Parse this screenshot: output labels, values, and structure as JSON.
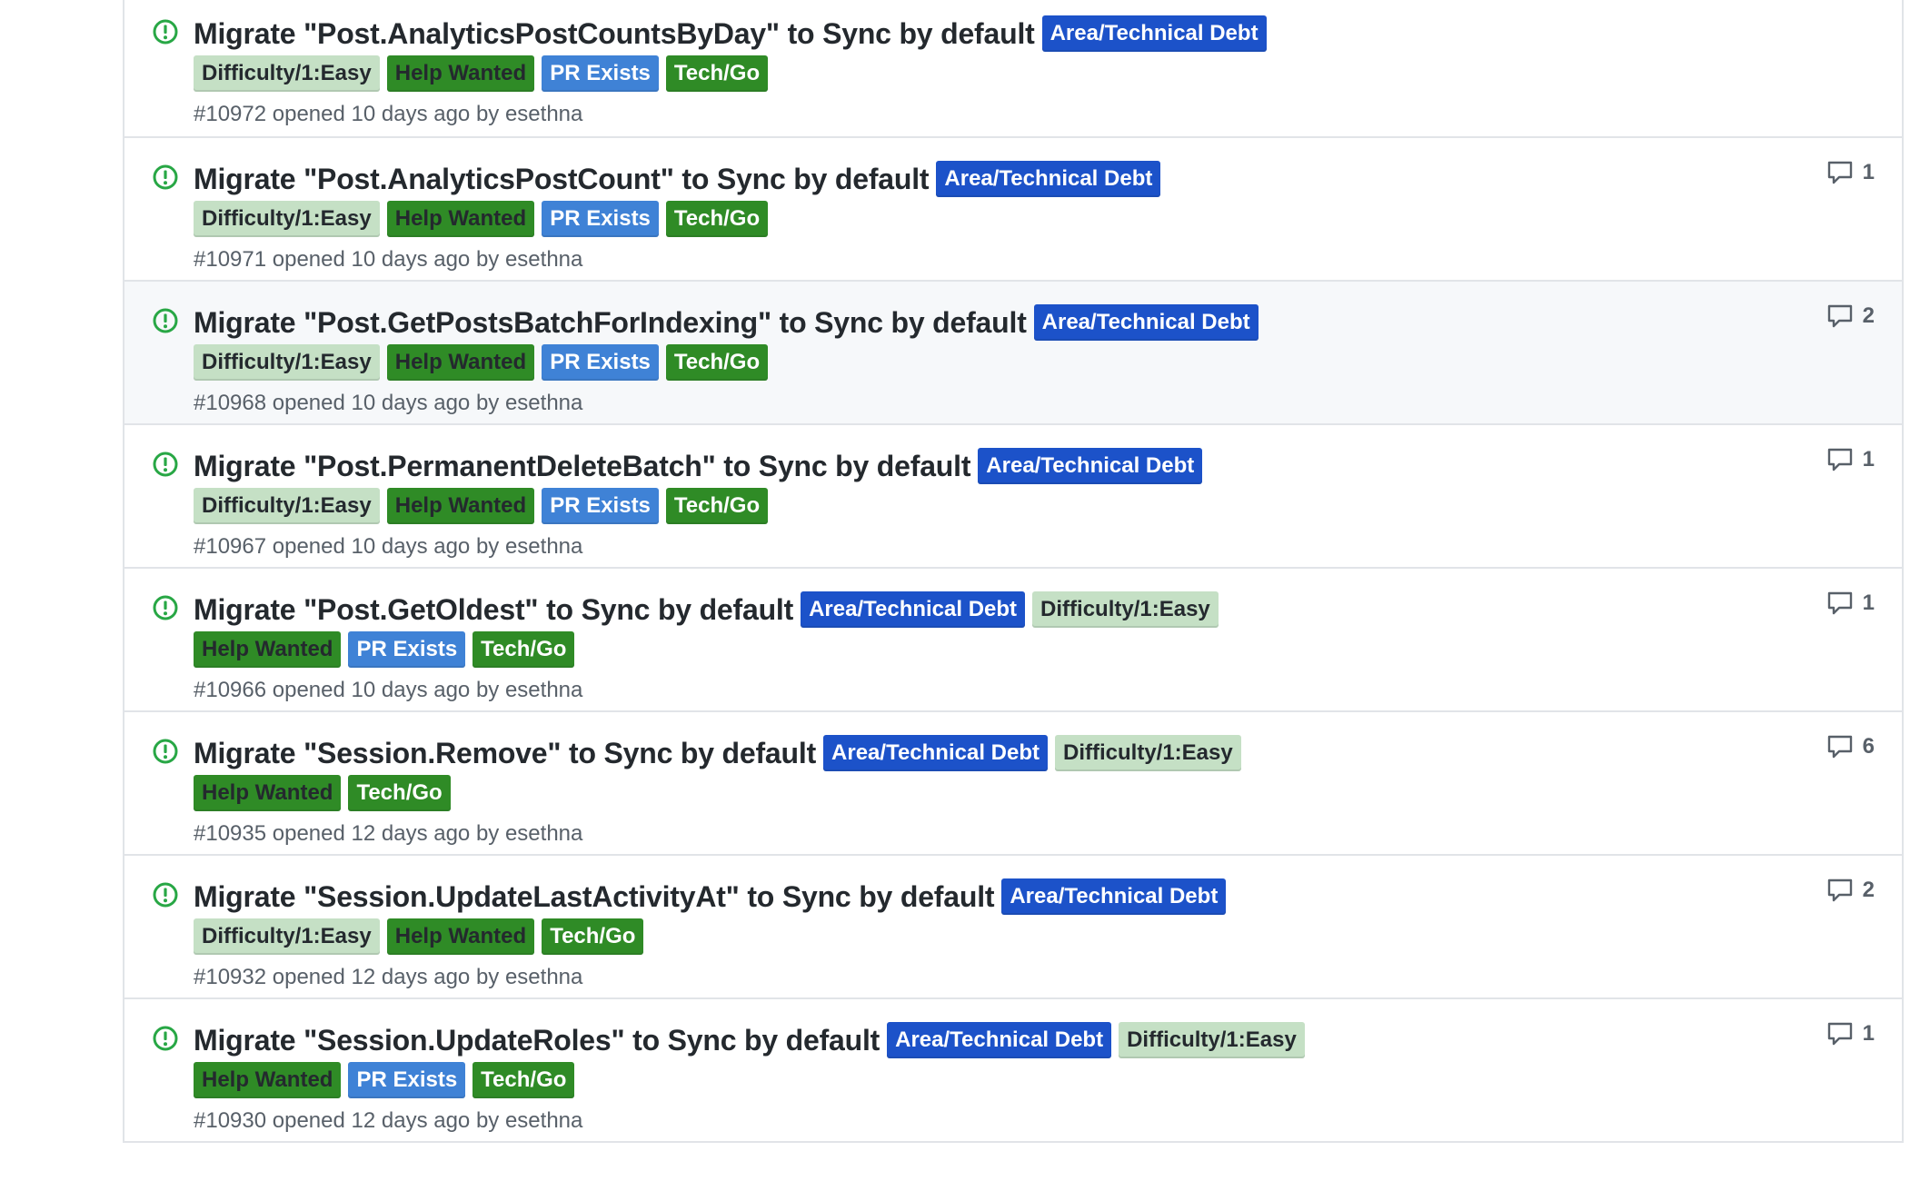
{
  "colors": {
    "area": "#1c52c9",
    "difficulty": "#c5e0c5",
    "help": "#2f8b26",
    "pr": "#3f82d6",
    "tech": "#2f8b26",
    "open_icon": "#28a745"
  },
  "labels": {
    "area": "Area/Technical Debt",
    "difficulty": "Difficulty/1:Easy",
    "help": "Help Wanted",
    "pr": "PR Exists",
    "tech": "Tech/Go"
  },
  "issues": [
    {
      "title": "Migrate \"Post.AnalyticsPostCountsByDay\" to Sync by default",
      "meta": "#10972 opened 10 days ago by esethna",
      "comments": "",
      "inline": [
        "area"
      ],
      "second": [
        "difficulty",
        "help",
        "pr",
        "tech"
      ]
    },
    {
      "title": "Migrate \"Post.AnalyticsPostCount\" to Sync by default",
      "meta": "#10971 opened 10 days ago by esethna",
      "comments": "1",
      "inline": [
        "area"
      ],
      "second": [
        "difficulty",
        "help",
        "pr",
        "tech"
      ]
    },
    {
      "title": "Migrate \"Post.GetPostsBatchForIndexing\" to Sync by default",
      "meta": "#10968 opened 10 days ago by esethna",
      "comments": "2",
      "inline": [
        "area"
      ],
      "second": [
        "difficulty",
        "help",
        "pr",
        "tech"
      ],
      "hover": true
    },
    {
      "title": "Migrate \"Post.PermanentDeleteBatch\" to Sync by default",
      "meta": "#10967 opened 10 days ago by esethna",
      "comments": "1",
      "inline": [
        "area"
      ],
      "second": [
        "difficulty",
        "help",
        "pr",
        "tech"
      ]
    },
    {
      "title": "Migrate \"Post.GetOldest\" to Sync by default",
      "meta": "#10966 opened 10 days ago by esethna",
      "comments": "1",
      "inline": [
        "area",
        "difficulty"
      ],
      "second": [
        "help",
        "pr",
        "tech"
      ]
    },
    {
      "title": "Migrate \"Session.Remove\" to Sync by default",
      "meta": "#10935 opened 12 days ago by esethna",
      "comments": "6",
      "inline": [
        "area",
        "difficulty"
      ],
      "second": [
        "help",
        "tech"
      ]
    },
    {
      "title": "Migrate \"Session.UpdateLastActivityAt\" to Sync by default",
      "meta": "#10932 opened 12 days ago by esethna",
      "comments": "2",
      "inline": [
        "area"
      ],
      "second": [
        "difficulty",
        "help",
        "tech"
      ]
    },
    {
      "title": "Migrate \"Session.UpdateRoles\" to Sync by default",
      "meta": "#10930 opened 12 days ago by esethna",
      "comments": "1",
      "inline": [
        "area",
        "difficulty"
      ],
      "second": [
        "help",
        "pr",
        "tech"
      ]
    }
  ]
}
